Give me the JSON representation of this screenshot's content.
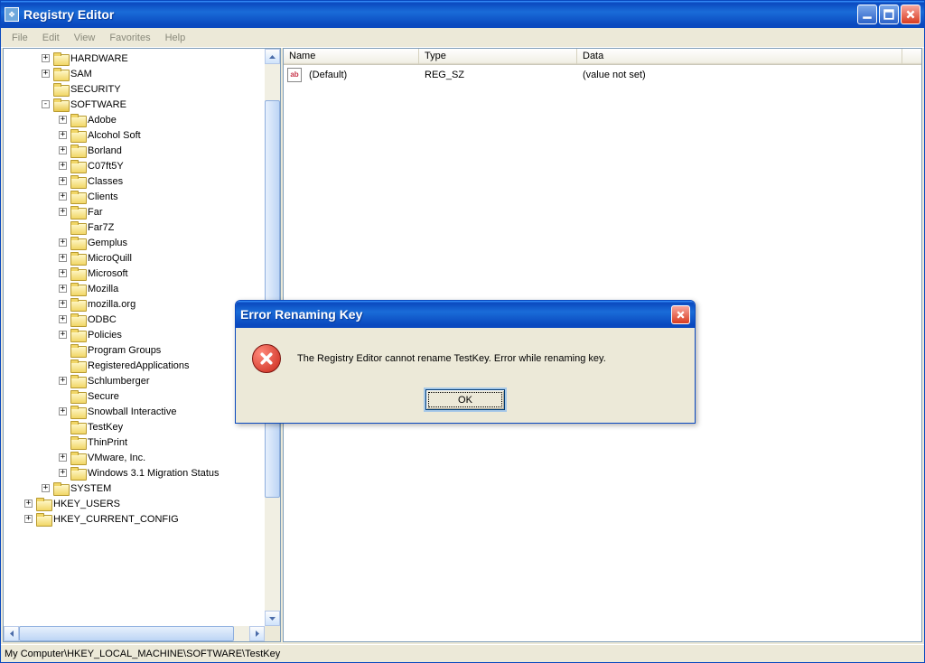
{
  "window": {
    "title": "Registry Editor"
  },
  "menu": {
    "file": "File",
    "edit": "Edit",
    "view": "View",
    "favorites": "Favorites",
    "help": "Help"
  },
  "tree": {
    "items": [
      {
        "indent": 2,
        "exp": "+",
        "label": "HARDWARE"
      },
      {
        "indent": 2,
        "exp": "+",
        "label": "SAM"
      },
      {
        "indent": 2,
        "exp": "",
        "label": "SECURITY"
      },
      {
        "indent": 2,
        "exp": "-",
        "label": "SOFTWARE",
        "open": true
      },
      {
        "indent": 3,
        "exp": "+",
        "label": "Adobe"
      },
      {
        "indent": 3,
        "exp": "+",
        "label": "Alcohol Soft"
      },
      {
        "indent": 3,
        "exp": "+",
        "label": "Borland"
      },
      {
        "indent": 3,
        "exp": "+",
        "label": "C07ft5Y"
      },
      {
        "indent": 3,
        "exp": "+",
        "label": "Classes"
      },
      {
        "indent": 3,
        "exp": "+",
        "label": "Clients"
      },
      {
        "indent": 3,
        "exp": "+",
        "label": "Far"
      },
      {
        "indent": 3,
        "exp": "",
        "label": "Far7Z"
      },
      {
        "indent": 3,
        "exp": "+",
        "label": "Gemplus"
      },
      {
        "indent": 3,
        "exp": "+",
        "label": "MicroQuill"
      },
      {
        "indent": 3,
        "exp": "+",
        "label": "Microsoft"
      },
      {
        "indent": 3,
        "exp": "+",
        "label": "Mozilla"
      },
      {
        "indent": 3,
        "exp": "+",
        "label": "mozilla.org"
      },
      {
        "indent": 3,
        "exp": "+",
        "label": "ODBC"
      },
      {
        "indent": 3,
        "exp": "+",
        "label": "Policies"
      },
      {
        "indent": 3,
        "exp": "",
        "label": "Program Groups"
      },
      {
        "indent": 3,
        "exp": "",
        "label": "RegisteredApplications"
      },
      {
        "indent": 3,
        "exp": "+",
        "label": "Schlumberger"
      },
      {
        "indent": 3,
        "exp": "",
        "label": "Secure"
      },
      {
        "indent": 3,
        "exp": "+",
        "label": "Snowball Interactive"
      },
      {
        "indent": 3,
        "exp": "",
        "label": "TestKey"
      },
      {
        "indent": 3,
        "exp": "",
        "label": "ThinPrint"
      },
      {
        "indent": 3,
        "exp": "+",
        "label": "VMware, Inc."
      },
      {
        "indent": 3,
        "exp": "+",
        "label": "Windows 3.1 Migration Status"
      },
      {
        "indent": 2,
        "exp": "+",
        "label": "SYSTEM"
      },
      {
        "indent": 1,
        "exp": "+",
        "label": "HKEY_USERS"
      },
      {
        "indent": 1,
        "exp": "+",
        "label": "HKEY_CURRENT_CONFIG"
      }
    ]
  },
  "list": {
    "columns": {
      "name": "Name",
      "type": "Type",
      "data": "Data"
    },
    "col_widths": {
      "name": 150,
      "type": 175,
      "data": 360
    },
    "rows": [
      {
        "name": "(Default)",
        "type": "REG_SZ",
        "data": "(value not set)",
        "icon": "ab"
      }
    ]
  },
  "statusbar": {
    "path": "My Computer\\HKEY_LOCAL_MACHINE\\SOFTWARE\\TestKey"
  },
  "dialog": {
    "title": "Error Renaming Key",
    "message": "The Registry Editor cannot rename TestKey. Error while renaming key.",
    "ok": "OK"
  }
}
